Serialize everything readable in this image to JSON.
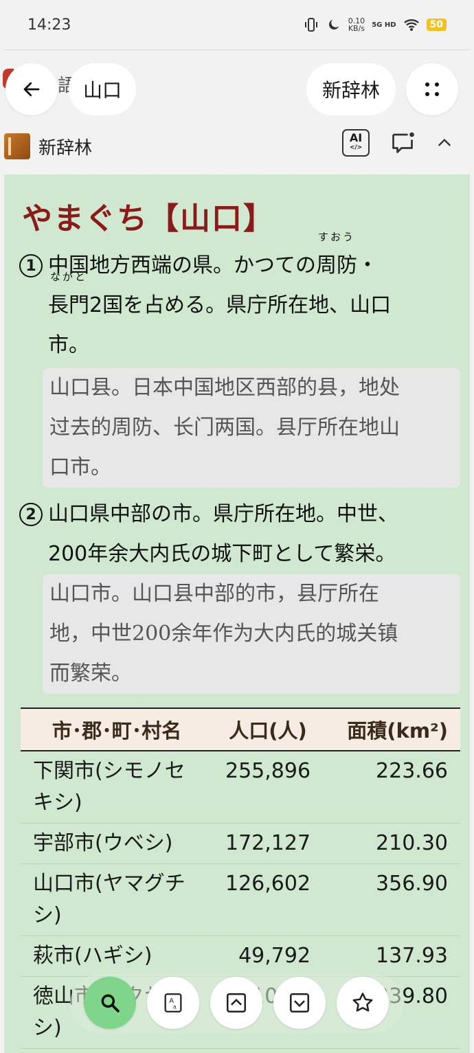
{
  "status_bar": {
    "time": "14:23",
    "net_speed_value": "0.10",
    "net_speed_unit": "KB/s",
    "network": "5G HD",
    "battery": "50"
  },
  "topbar": {
    "query": "山口",
    "dictionary_pill": "新辞林",
    "bg_dict_fragment": "語"
  },
  "dict_header": {
    "name": "新辞林",
    "ai_label": "AI"
  },
  "entry": {
    "headword": "やまぐち【山口】",
    "senses": [
      {
        "num": "1",
        "line1_pre": "中国地方西端の県。かつての",
        "ruby1_base": "周防",
        "ruby1_text": "すおう",
        "line1_post": "・",
        "ruby2_base": "長門",
        "ruby2_text": "ながと",
        "line2_post": "2国を占める。県庁所在地、山口",
        "line3": "市。",
        "translation": [
          "山口县。日本中国地区西部的县，地处",
          "过去的周防、长门两国。县厅所在地山",
          "口市。"
        ]
      },
      {
        "num": "2",
        "lines": [
          "山口県中部の市。県庁所在地。中世、",
          "200年余大内氏の城下町として繁栄。"
        ],
        "translation": [
          "山口市。山口县中部的市，县厅所在",
          "地，中世200余年作为大内氏的城关镇",
          "而繁荣。"
        ]
      }
    ]
  },
  "table": {
    "headers": [
      "市･郡･町･村名",
      "人口(人)",
      "面積(km²)"
    ],
    "rows": [
      {
        "name": "下関市(シモノセキシ)",
        "population": "255,896",
        "area": "223.66"
      },
      {
        "name": "宇部市(ウベシ)",
        "population": "172,127",
        "area": "210.30"
      },
      {
        "name": "山口市(ヤマグチシ)",
        "population": "126,602",
        "area": "356.90"
      },
      {
        "name": "萩市(ハギシ)",
        "population": "49,792",
        "area": "137.93"
      },
      {
        "name": "徳山市(トクヤマシ)",
        "population": "109,5",
        "area": "239.80"
      }
    ]
  },
  "colors": {
    "content_bg": "#cfe8cf",
    "headword": "#8b1a1a",
    "search_fab": "#7fd58a"
  },
  "icons": [
    "back-arrow-icon",
    "grid-dots-icon",
    "ai-code-icon",
    "comment-icon",
    "chevron-up-icon",
    "search-icon",
    "translate-icon",
    "page-up-icon",
    "page-down-icon",
    "star-icon"
  ]
}
